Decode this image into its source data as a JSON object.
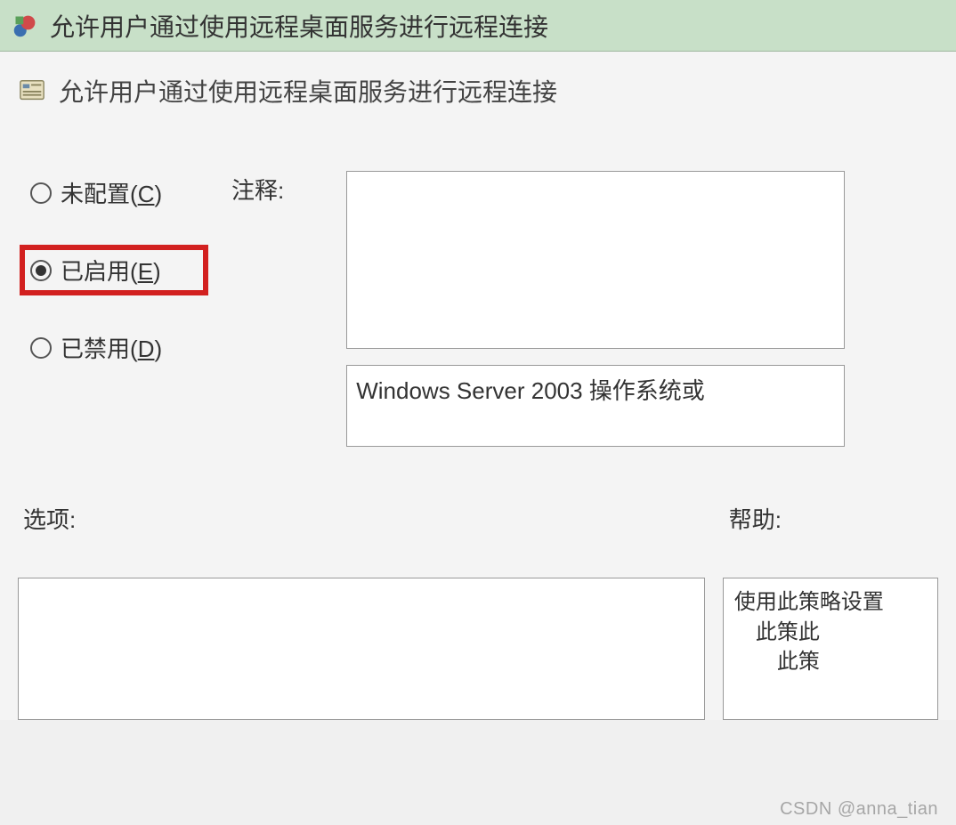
{
  "titlebar": {
    "title": "允许用户通过使用远程桌面服务进行远程连接"
  },
  "header": {
    "title": "允许用户通过使用远程桌面服务进行远程连接"
  },
  "radios": {
    "not_configured": {
      "label": "未配置",
      "hotkey": "C"
    },
    "enabled": {
      "label": "已启用",
      "hotkey": "E"
    },
    "disabled": {
      "label": "已禁用",
      "hotkey": "D"
    }
  },
  "labels": {
    "comment": "注释:",
    "options": "选项:",
    "help": "帮助:"
  },
  "support_box": "Windows Server 2003 操作系统或",
  "help_text": {
    "line1": "使用此策略设置",
    "line2": "此策此",
    "line3": "此策"
  },
  "watermark": "CSDN @anna_tian"
}
